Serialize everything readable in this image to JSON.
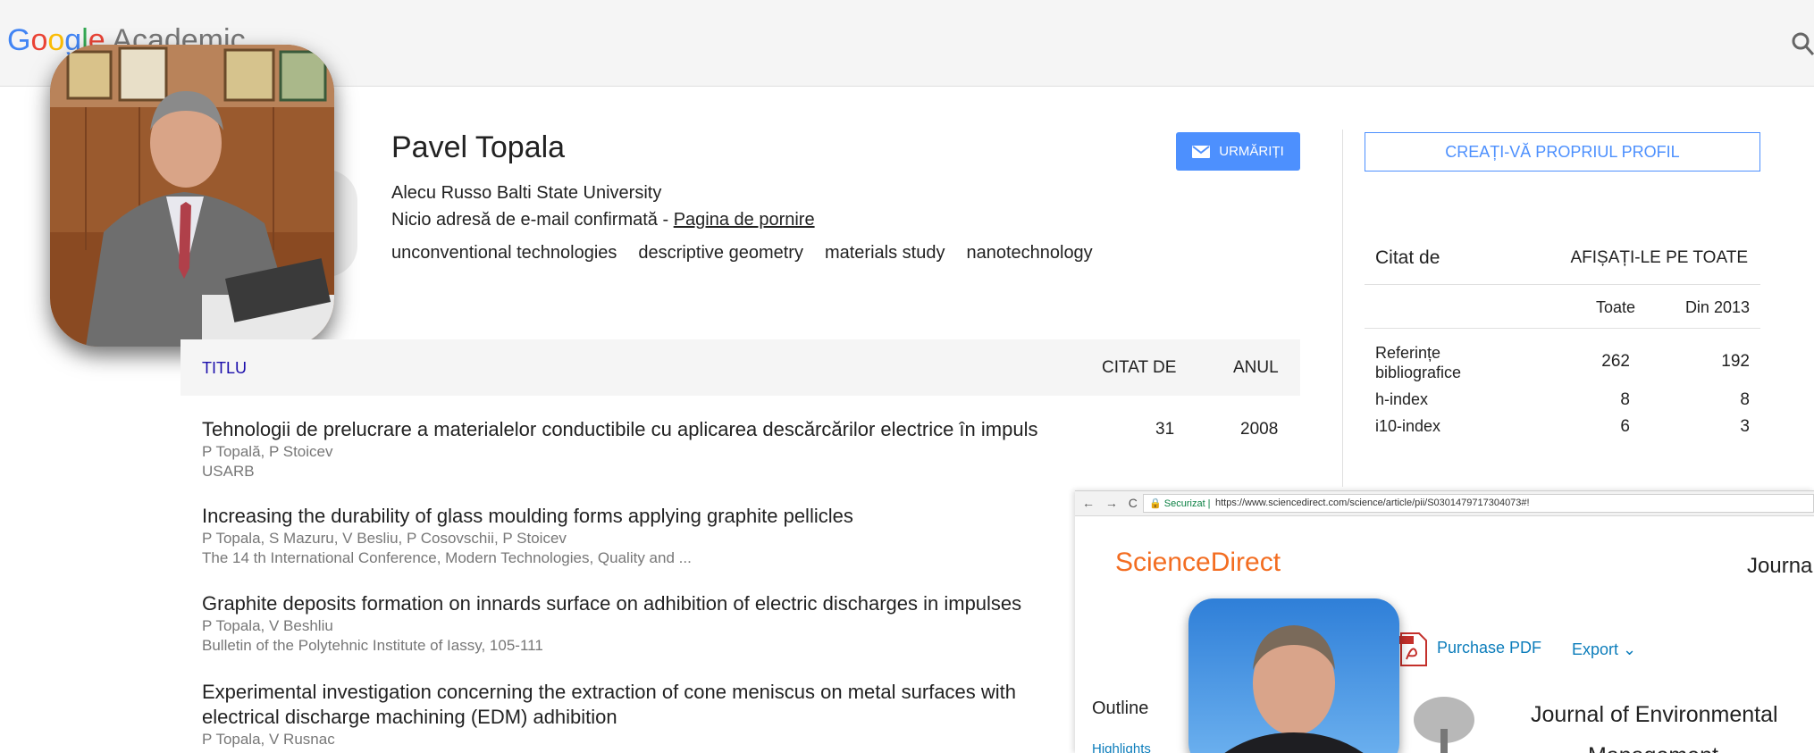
{
  "header": {
    "logo_google_parts": [
      "G",
      "o",
      "o",
      "g",
      "l",
      "e"
    ],
    "logo_suffix": "Academic"
  },
  "profile": {
    "name": "Pavel Topala",
    "affiliation": "Alecu Russo Balti State University",
    "email_text": "Nicio adresă de e-mail confirmată - ",
    "homepage_link": "Pagina de pornire",
    "interests": [
      "unconventional technologies",
      "descriptive geometry",
      "materials study",
      "nanotechnology"
    ],
    "follow_label": "URMĂRIȚI"
  },
  "create_profile_label": "CREAȚI-VĂ PROPRIUL PROFIL",
  "cited_by": {
    "title": "Citat de",
    "show_all": "AFIȘAȚI-LE PE TOATE",
    "col_all": "Toate",
    "col_since": "Din 2013",
    "rows": [
      {
        "label": "Referințe bibliografice",
        "all": "262",
        "since": "192"
      },
      {
        "label": "h-index",
        "all": "8",
        "since": "8"
      },
      {
        "label": "i10-index",
        "all": "6",
        "since": "3"
      }
    ]
  },
  "table": {
    "col_title": "TITLU",
    "col_cited": "CITAT DE",
    "col_year": "ANUL"
  },
  "articles": [
    {
      "title": "Tehnologii de prelucrare a materialelor conductibile cu aplicarea descărcărilor electrice în impuls",
      "authors": "P Topală, P Stoicev",
      "venue": "USARB",
      "cited": "31",
      "year": "2008"
    },
    {
      "title": "Increasing the durability of glass moulding forms applying graphite pellicles",
      "authors": "P Topala, S Mazuru, V Besliu, P Cosovschii, P Stoicev",
      "venue": "The 14 th International Conference, Modern Technologies, Quality and ..."
    },
    {
      "title": "Graphite deposits formation on innards surface on adhibition of electric discharges in impulses",
      "authors": "P Topala, V Beshliu",
      "venue": "Bulletin of the Polytehnic Institute of Iassy, 105-111"
    },
    {
      "title": "Experimental investigation concerning the extraction of cone meniscus on metal surfaces with electrical discharge machining (EDM) adhibition",
      "authors": "P Topala, V Rusnac"
    }
  ],
  "inset_browser": {
    "nav_glyphs": "← → C",
    "secure_label": "Securizat",
    "url": "https://www.sciencedirect.com/science/article/pii/S030147971730407​3#!",
    "brand": "ScienceDirect",
    "journals_label": "Journals",
    "purchase_pdf": "Purchase PDF",
    "export": "Export",
    "outline": "Outline",
    "highlights": "Highlights",
    "journal_title": "Journal of Environmental",
    "journal_title_cont": "Management"
  },
  "colors": {
    "accent_blue": "#4d90fe",
    "sd_orange": "#f36d21",
    "link_blue": "#0c7dbb"
  }
}
